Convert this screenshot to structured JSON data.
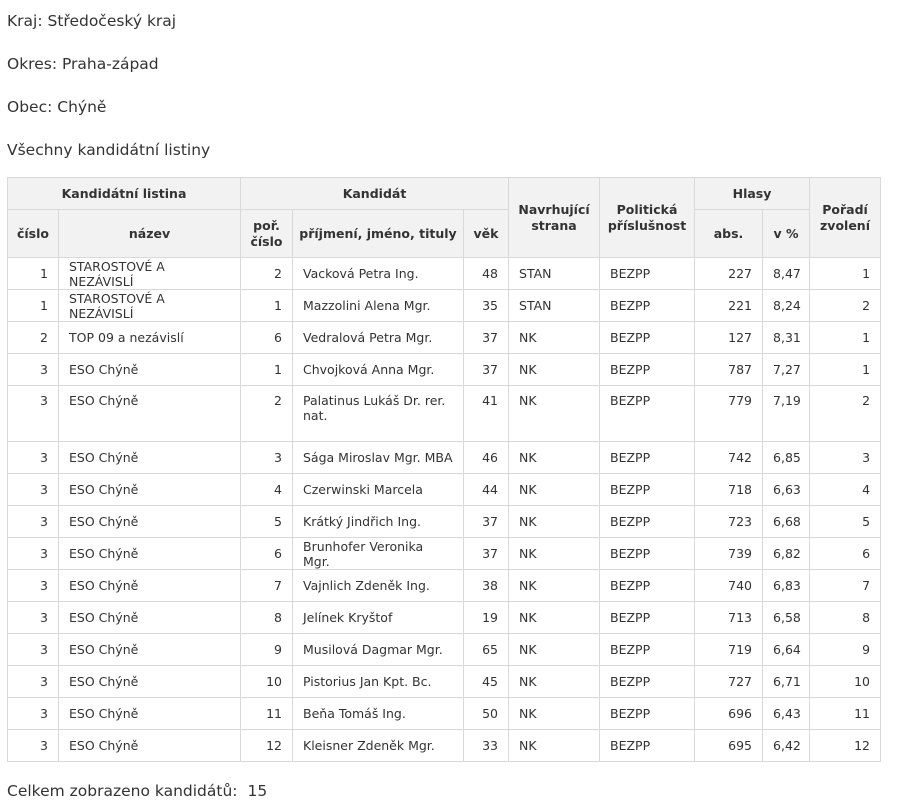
{
  "header": {
    "kraj": "Kraj: Středočeský kraj",
    "okres": "Okres: Praha-západ",
    "obec": "Obec: Chýně",
    "all_lists": "Všechny kandidátní listiny"
  },
  "table": {
    "group_headers": {
      "list": "Kandidátní listina",
      "candidate": "Kandidát",
      "nominating": "Navrhující strana",
      "political": "Politická příslušnost",
      "votes": "Hlasy",
      "order": "Pořadí zvolení"
    },
    "sub_headers": {
      "cislo": "číslo",
      "nazev": "název",
      "por_cislo": "poř. číslo",
      "name": "příjmení, jméno, tituly",
      "vek": "věk",
      "abs": "abs.",
      "pct": "v %"
    },
    "rows": [
      {
        "cislo": "1",
        "nazev": "STAROSTOVÉ A NEZÁVISLÍ",
        "por": "2",
        "name": "Vacková Petra Ing.",
        "vek": "48",
        "strana": "STAN",
        "prislusnost": "BEZPP",
        "abs": "227",
        "pct": "8,47",
        "poradi": "1"
      },
      {
        "cislo": "1",
        "nazev": "STAROSTOVÉ A NEZÁVISLÍ",
        "por": "1",
        "name": "Mazzolini Alena Mgr.",
        "vek": "35",
        "strana": "STAN",
        "prislusnost": "BEZPP",
        "abs": "221",
        "pct": "8,24",
        "poradi": "2"
      },
      {
        "cislo": "2",
        "nazev": "TOP 09 a nezávislí",
        "por": "6",
        "name": "Vedralová Petra Mgr.",
        "vek": "37",
        "strana": "NK",
        "prislusnost": "BEZPP",
        "abs": "127",
        "pct": "8,31",
        "poradi": "1"
      },
      {
        "cislo": "3",
        "nazev": "ESO Chýně",
        "por": "1",
        "name": "Chvojková Anna Mgr.",
        "vek": "37",
        "strana": "NK",
        "prislusnost": "BEZPP",
        "abs": "787",
        "pct": "7,27",
        "poradi": "1"
      },
      {
        "cislo": "3",
        "nazev": "ESO Chýně",
        "por": "2",
        "name": "Palatinus Lukáš Dr. rer. nat.",
        "vek": "41",
        "strana": "NK",
        "prislusnost": "BEZPP",
        "abs": "779",
        "pct": "7,19",
        "poradi": "2"
      },
      {
        "cislo": "3",
        "nazev": "ESO Chýně",
        "por": "3",
        "name": "Sága Miroslav Mgr. MBA",
        "vek": "46",
        "strana": "NK",
        "prislusnost": "BEZPP",
        "abs": "742",
        "pct": "6,85",
        "poradi": "3"
      },
      {
        "cislo": "3",
        "nazev": "ESO Chýně",
        "por": "4",
        "name": "Czerwinski Marcela",
        "vek": "44",
        "strana": "NK",
        "prislusnost": "BEZPP",
        "abs": "718",
        "pct": "6,63",
        "poradi": "4"
      },
      {
        "cislo": "3",
        "nazev": "ESO Chýně",
        "por": "5",
        "name": "Krátký Jindřich Ing.",
        "vek": "37",
        "strana": "NK",
        "prislusnost": "BEZPP",
        "abs": "723",
        "pct": "6,68",
        "poradi": "5"
      },
      {
        "cislo": "3",
        "nazev": "ESO Chýně",
        "por": "6",
        "name": "Brunhofer Veronika Mgr.",
        "vek": "37",
        "strana": "NK",
        "prislusnost": "BEZPP",
        "abs": "739",
        "pct": "6,82",
        "poradi": "6"
      },
      {
        "cislo": "3",
        "nazev": "ESO Chýně",
        "por": "7",
        "name": "Vajnlich Zdeněk Ing.",
        "vek": "38",
        "strana": "NK",
        "prislusnost": "BEZPP",
        "abs": "740",
        "pct": "6,83",
        "poradi": "7"
      },
      {
        "cislo": "3",
        "nazev": "ESO Chýně",
        "por": "8",
        "name": "Jelínek Kryštof",
        "vek": "19",
        "strana": "NK",
        "prislusnost": "BEZPP",
        "abs": "713",
        "pct": "6,58",
        "poradi": "8"
      },
      {
        "cislo": "3",
        "nazev": "ESO Chýně",
        "por": "9",
        "name": "Musilová Dagmar Mgr.",
        "vek": "65",
        "strana": "NK",
        "prislusnost": "BEZPP",
        "abs": "719",
        "pct": "6,64",
        "poradi": "9"
      },
      {
        "cislo": "3",
        "nazev": "ESO Chýně",
        "por": "10",
        "name": "Pistorius Jan Kpt. Bc.",
        "vek": "45",
        "strana": "NK",
        "prislusnost": "BEZPP",
        "abs": "727",
        "pct": "6,71",
        "poradi": "10"
      },
      {
        "cislo": "3",
        "nazev": "ESO Chýně",
        "por": "11",
        "name": "Beňa Tomáš Ing.",
        "vek": "50",
        "strana": "NK",
        "prislusnost": "BEZPP",
        "abs": "696",
        "pct": "6,43",
        "poradi": "11"
      },
      {
        "cislo": "3",
        "nazev": "ESO Chýně",
        "por": "12",
        "name": "Kleisner Zdeněk Mgr.",
        "vek": "33",
        "strana": "NK",
        "prislusnost": "BEZPP",
        "abs": "695",
        "pct": "6,42",
        "poradi": "12"
      }
    ]
  },
  "footer": {
    "label": "Celkem zobrazeno kandidátů:",
    "count": "15"
  }
}
